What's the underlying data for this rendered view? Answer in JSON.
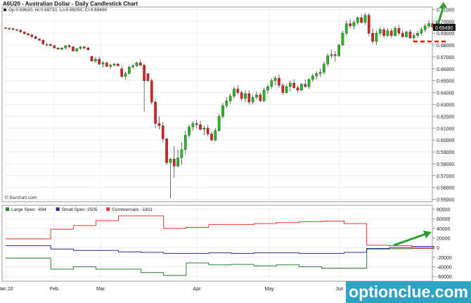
{
  "title": "A6U20 - Australian Dollar - Daily Candlestick Chart",
  "ohlc_label": "Op:0.69630, Hi:0.69720, Lo:0.69250, Cl:0.69490",
  "last_price_label": "0.69490",
  "watermark": "© Barchart.com",
  "brand": "optionclue.com",
  "colors": {
    "up": "#22bb22",
    "down": "#dd2222",
    "large_spec": "#2e7d32",
    "small_spec": "#2a2a8a",
    "commercials": "#e53935",
    "dash_line": "#ee1111",
    "arrow": "#2ea02e",
    "brand_bg": "#2fa3c4"
  },
  "chart_data": [
    {
      "type": "candlestick",
      "title": "A6U20 - Australian Dollar - Daily Candlestick Chart",
      "x_ticks": [
        "Jan 20",
        "Feb",
        "Mar",
        "Apr",
        "May",
        "Jun"
      ],
      "y_ticks": [
        "0.71000",
        "0.70000",
        "0.69000",
        "0.68000",
        "0.67000",
        "0.66000",
        "0.65000",
        "0.64000",
        "0.63000",
        "0.62000",
        "0.61000",
        "0.60000",
        "0.59000",
        "0.58000",
        "0.57000",
        "0.56000",
        "0.55000"
      ],
      "ylim": [
        0.548,
        0.712
      ],
      "series": [
        {
          "values": [
            [
              0.6945,
              0.695,
              0.6935,
              0.694
            ],
            [
              0.694,
              0.6948,
              0.6932,
              0.6938
            ],
            [
              0.6938,
              0.6945,
              0.6928,
              0.693
            ],
            [
              0.693,
              0.6938,
              0.692,
              0.6925
            ],
            [
              0.6925,
              0.6932,
              0.6905,
              0.691
            ],
            [
              0.691,
              0.6915,
              0.689,
              0.6895
            ],
            [
              0.6895,
              0.69,
              0.688,
              0.6885
            ],
            [
              0.6885,
              0.6895,
              0.686,
              0.687
            ],
            [
              0.687,
              0.688,
              0.685,
              0.6855
            ],
            [
              0.685,
              0.6862,
              0.6835,
              0.684
            ],
            [
              0.684,
              0.685,
              0.68,
              0.681
            ],
            [
              0.68,
              0.6815,
              0.679,
              0.6805
            ],
            [
              0.6805,
              0.6815,
              0.679,
              0.6795
            ],
            [
              0.6795,
              0.68,
              0.677,
              0.6775
            ],
            [
              0.6775,
              0.678,
              0.676,
              0.6765
            ],
            [
              0.6765,
              0.678,
              0.6755,
              0.6775
            ],
            [
              0.6775,
              0.68,
              0.6765,
              0.6795
            ],
            [
              0.6795,
              0.6805,
              0.6775,
              0.6785
            ],
            [
              0.6785,
              0.679,
              0.6745,
              0.675
            ],
            [
              0.675,
              0.6775,
              0.674,
              0.677
            ],
            [
              0.677,
              0.679,
              0.676,
              0.6785
            ],
            [
              0.6785,
              0.679,
              0.6765,
              0.6775
            ],
            [
              0.6775,
              0.6785,
              0.6755,
              0.676
            ],
            [
              0.6705,
              0.671,
              0.666,
              0.6665
            ],
            [
              0.6665,
              0.67,
              0.665,
              0.668
            ],
            [
              0.668,
              0.67,
              0.663,
              0.664
            ],
            [
              0.664,
              0.6665,
              0.661,
              0.665
            ],
            [
              0.665,
              0.666,
              0.6615,
              0.662
            ],
            [
              0.662,
              0.664,
              0.66,
              0.663
            ],
            [
              0.663,
              0.665,
              0.662,
              0.664
            ],
            [
              0.664,
              0.665,
              0.662,
              0.6625
            ],
            [
              0.66,
              0.6625,
              0.652,
              0.6535
            ],
            [
              0.6535,
              0.6575,
              0.651,
              0.656
            ],
            [
              0.656,
              0.6625,
              0.655,
              0.6615
            ],
            [
              0.6615,
              0.664,
              0.66,
              0.6625
            ],
            [
              0.6625,
              0.666,
              0.6615,
              0.665
            ],
            [
              0.665,
              0.6675,
              0.662,
              0.663
            ],
            [
              0.663,
              0.664,
              0.624,
              0.65
            ],
            [
              0.656,
              0.656,
              0.649,
              0.65
            ],
            [
              0.65,
              0.652,
              0.63,
              0.632
            ],
            [
              0.632,
              0.634,
              0.61,
              0.614
            ],
            [
              0.614,
              0.62,
              0.609,
              0.612
            ],
            [
              0.612,
              0.615,
              0.598,
              0.601
            ],
            [
              0.601,
              0.602,
              0.579,
              0.581
            ],
            [
              0.581,
              0.585,
              0.551,
              0.584
            ],
            [
              0.584,
              0.595,
              0.568,
              0.578
            ],
            [
              0.578,
              0.592,
              0.577,
              0.585
            ],
            [
              0.585,
              0.598,
              0.579,
              0.592
            ],
            [
              0.592,
              0.608,
              0.588,
              0.604
            ],
            [
              0.604,
              0.613,
              0.602,
              0.611
            ],
            [
              0.611,
              0.616,
              0.608,
              0.614
            ],
            [
              0.614,
              0.617,
              0.61,
              0.613
            ],
            [
              0.613,
              0.616,
              0.608,
              0.609
            ],
            [
              0.609,
              0.612,
              0.604,
              0.61
            ],
            [
              0.61,
              0.613,
              0.603,
              0.605
            ],
            [
              0.605,
              0.607,
              0.599,
              0.6
            ],
            [
              0.6,
              0.61,
              0.599,
              0.608
            ],
            [
              0.608,
              0.622,
              0.607,
              0.62
            ],
            [
              0.62,
              0.631,
              0.618,
              0.629
            ],
            [
              0.629,
              0.636,
              0.627,
              0.633
            ],
            [
              0.633,
              0.639,
              0.63,
              0.637
            ],
            [
              0.637,
              0.645,
              0.635,
              0.643
            ],
            [
              0.643,
              0.646,
              0.638,
              0.64
            ],
            [
              0.64,
              0.642,
              0.633,
              0.635
            ],
            [
              0.635,
              0.642,
              0.632,
              0.639
            ],
            [
              0.639,
              0.642,
              0.63,
              0.632
            ],
            [
              0.632,
              0.638,
              0.63,
              0.636
            ],
            [
              0.636,
              0.641,
              0.634,
              0.638
            ],
            [
              0.638,
              0.64,
              0.632,
              0.633
            ],
            [
              0.633,
              0.644,
              0.632,
              0.642
            ],
            [
              0.642,
              0.647,
              0.639,
              0.645
            ],
            [
              0.645,
              0.652,
              0.643,
              0.65
            ],
            [
              0.65,
              0.654,
              0.646,
              0.652
            ],
            [
              0.652,
              0.655,
              0.644,
              0.646
            ],
            [
              0.646,
              0.648,
              0.638,
              0.64
            ],
            [
              0.64,
              0.647,
              0.639,
              0.645
            ],
            [
              0.645,
              0.65,
              0.641,
              0.648
            ],
            [
              0.648,
              0.651,
              0.643,
              0.644
            ],
            [
              0.644,
              0.646,
              0.64,
              0.642
            ],
            [
              0.642,
              0.648,
              0.641,
              0.647
            ],
            [
              0.647,
              0.651,
              0.644,
              0.645
            ],
            [
              0.645,
              0.652,
              0.643,
              0.651
            ],
            [
              0.651,
              0.656,
              0.649,
              0.654
            ],
            [
              0.654,
              0.658,
              0.651,
              0.656
            ],
            [
              0.656,
              0.66,
              0.653,
              0.657
            ],
            [
              0.657,
              0.666,
              0.655,
              0.664
            ],
            [
              0.664,
              0.673,
              0.662,
              0.671
            ],
            [
              0.671,
              0.676,
              0.669,
              0.672
            ],
            [
              0.672,
              0.675,
              0.666,
              0.671
            ],
            [
              0.671,
              0.681,
              0.67,
              0.68
            ],
            [
              0.68,
              0.692,
              0.679,
              0.69
            ],
            [
              0.69,
              0.701,
              0.688,
              0.698
            ],
            [
              0.698,
              0.702,
              0.694,
              0.696
            ],
            [
              0.696,
              0.701,
              0.693,
              0.699
            ],
            [
              0.699,
              0.704,
              0.697,
              0.703
            ],
            [
              0.703,
              0.706,
              0.698,
              0.699
            ],
            [
              0.699,
              0.707,
              0.697,
              0.705
            ],
            [
              0.705,
              0.707,
              0.688,
              0.69
            ],
            [
              0.69,
              0.694,
              0.681,
              0.683
            ],
            [
              0.683,
              0.692,
              0.68,
              0.69
            ],
            [
              0.69,
              0.695,
              0.687,
              0.693
            ],
            [
              0.693,
              0.695,
              0.686,
              0.688
            ],
            [
              0.688,
              0.694,
              0.687,
              0.692
            ],
            [
              0.692,
              0.694,
              0.686,
              0.688
            ],
            [
              0.688,
              0.696,
              0.687,
              0.694
            ],
            [
              0.694,
              0.697,
              0.688,
              0.69
            ],
            [
              0.69,
              0.692,
              0.686,
              0.687
            ],
            [
              0.687,
              0.692,
              0.686,
              0.691
            ],
            [
              0.691,
              0.693,
              0.685,
              0.686
            ],
            [
              0.686,
              0.69,
              0.684,
              0.688
            ],
            [
              0.688,
              0.692,
              0.686,
              0.69
            ],
            [
              0.69,
              0.695,
              0.688,
              0.693
            ],
            [
              0.693,
              0.698,
              0.691,
              0.696
            ],
            [
              0.696,
              0.701,
              0.694,
              0.698
            ],
            [
              0.698,
              0.699,
              0.694,
              0.695
            ],
            [
              0.695,
              0.7,
              0.693,
              0.698
            ],
            [
              0.6963,
              0.6972,
              0.6925,
              0.6949
            ]
          ]
        }
      ],
      "resistance_level": 0.683
    },
    {
      "type": "line",
      "x_ticks": [
        "Jan 20",
        "Feb",
        "Mar",
        "Apr",
        "May",
        "Jun"
      ],
      "y_ticks": [
        "80000",
        "60000",
        "40000",
        "20000",
        "0",
        "-20000",
        "-40000",
        "-60000"
      ],
      "ylim": [
        -70000,
        88000
      ],
      "series": [
        {
          "name": "Large Spec: -694",
          "values": [
            -22000,
            -22000,
            -45000,
            -40000,
            -45000,
            -45000,
            -52000,
            -58000,
            -32000,
            -36000,
            -35000,
            -38000,
            -36000,
            -40000,
            -43000,
            -43000,
            -3000,
            -2500,
            -694,
            -694
          ]
        },
        {
          "name": "Small Spec: 2505",
          "values": [
            4000,
            4000,
            -3000,
            -6000,
            -6000,
            -9000,
            -10000,
            -12000,
            -12000,
            -11000,
            -12000,
            -11000,
            -11000,
            -12000,
            -12000,
            -10000,
            -2000,
            0,
            2505,
            2505
          ]
        },
        {
          "name": "Commercials: -1811",
          "values": [
            18000,
            18000,
            38000,
            46000,
            56000,
            66000,
            66000,
            40000,
            42000,
            48000,
            48000,
            50000,
            52000,
            54000,
            55000,
            50000,
            5000,
            4000,
            -1811,
            -1811
          ]
        }
      ]
    }
  ]
}
